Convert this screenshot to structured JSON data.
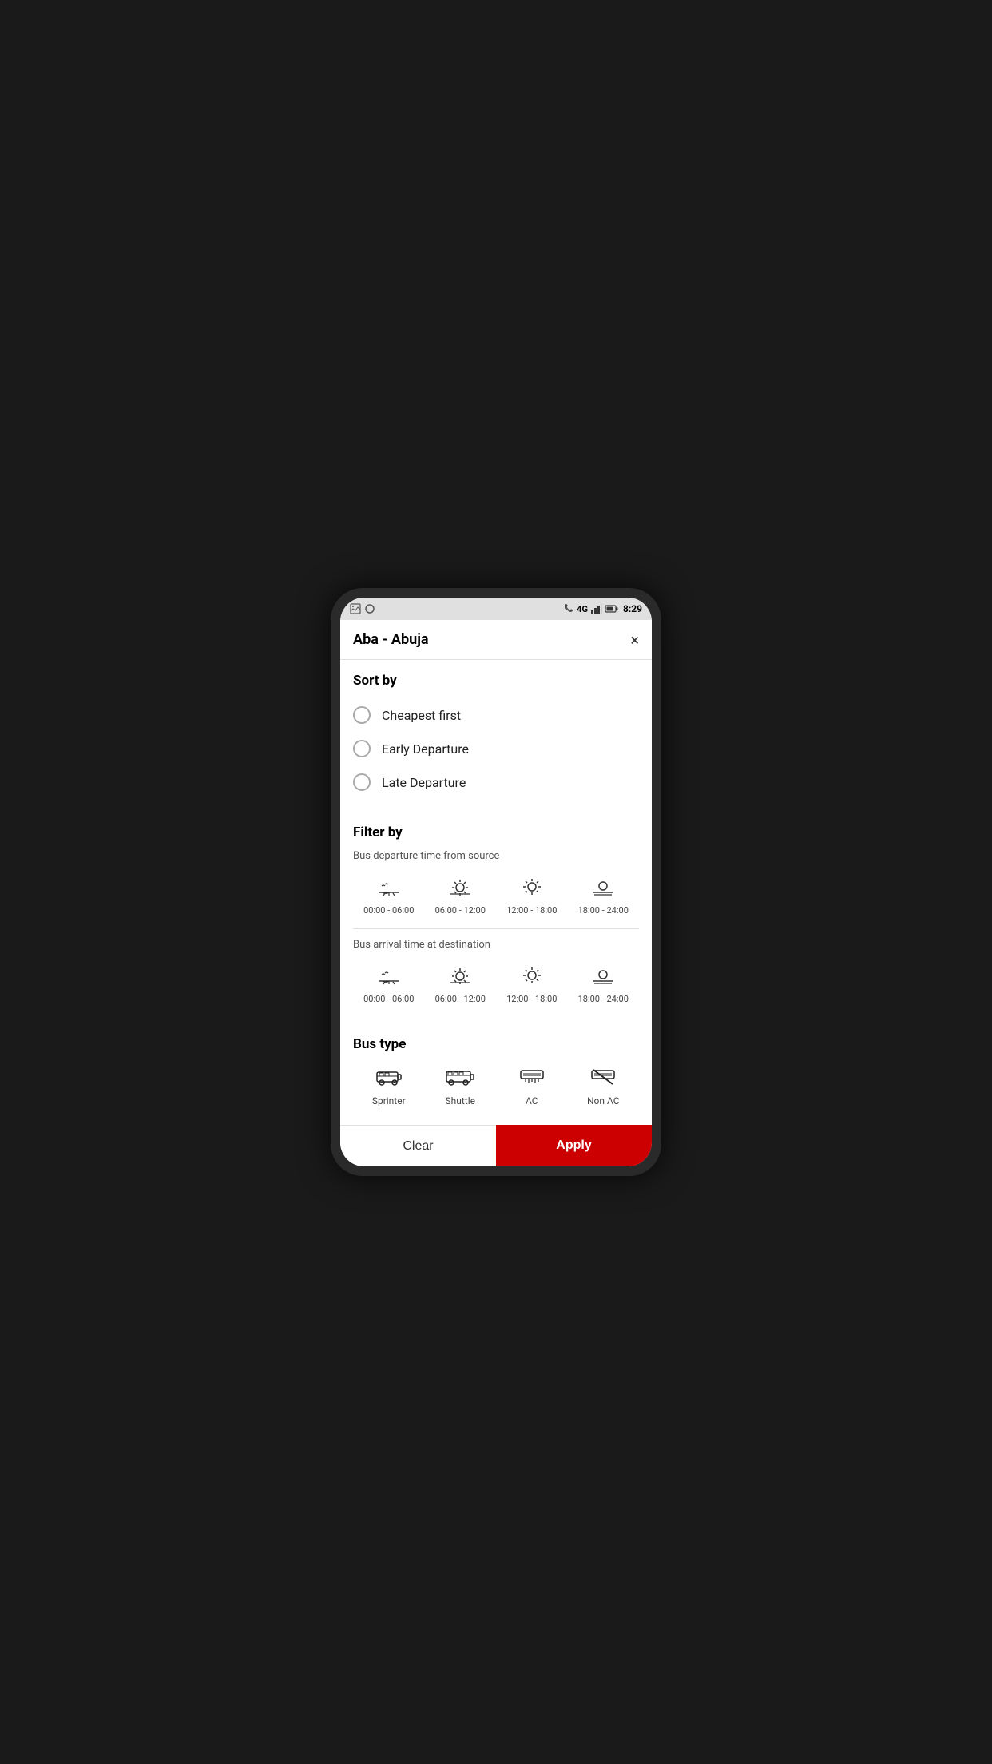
{
  "status": {
    "time": "8:29",
    "network": "4G",
    "battery": "⚡"
  },
  "header": {
    "title": "Aba - Abuja",
    "close_label": "×"
  },
  "sort_by": {
    "title": "Sort by",
    "options": [
      {
        "id": "cheapest",
        "label": "Cheapest first",
        "selected": false
      },
      {
        "id": "early",
        "label": "Early Departure",
        "selected": false
      },
      {
        "id": "late",
        "label": "Late Departure",
        "selected": false
      }
    ]
  },
  "filter_by": {
    "title": "Filter by",
    "departure_subtitle": "Bus departure time from source",
    "arrival_subtitle": "Bus arrival time at destination",
    "time_slots": [
      {
        "id": "slot1",
        "label": "00:00 - 06:00",
        "icon": "night"
      },
      {
        "id": "slot2",
        "label": "06:00 - 12:00",
        "icon": "morning"
      },
      {
        "id": "slot3",
        "label": "12:00 - 18:00",
        "icon": "afternoon"
      },
      {
        "id": "slot4",
        "label": "18:00 - 24:00",
        "icon": "evening"
      }
    ]
  },
  "bus_type": {
    "title": "Bus type",
    "types": [
      {
        "id": "sprinter",
        "label": "Sprinter",
        "icon": "sprinter"
      },
      {
        "id": "shuttle",
        "label": "Shuttle",
        "icon": "shuttle"
      },
      {
        "id": "ac",
        "label": "AC",
        "icon": "ac"
      },
      {
        "id": "nonac",
        "label": "Non AC",
        "icon": "nonac"
      }
    ]
  },
  "buttons": {
    "clear": "Clear",
    "apply": "Apply"
  }
}
